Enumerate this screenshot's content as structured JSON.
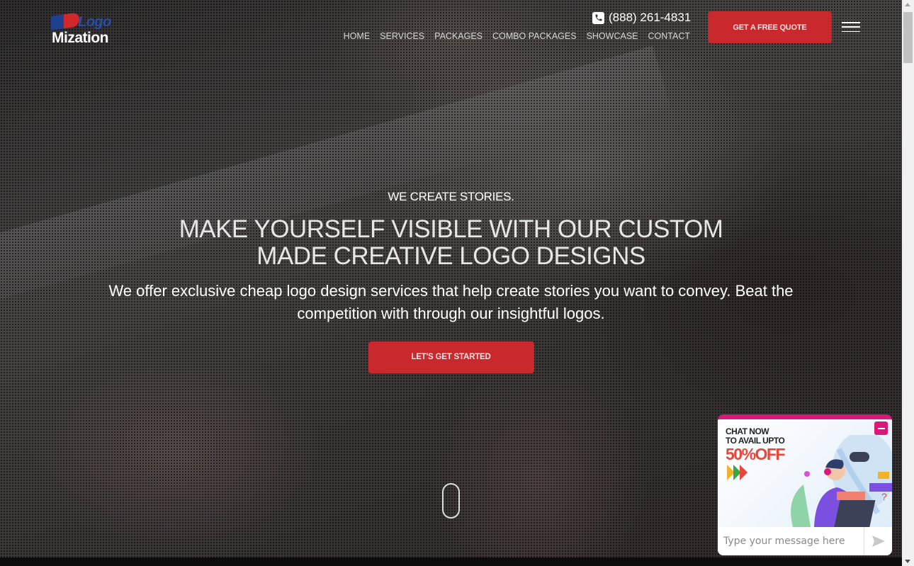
{
  "brand": {
    "logo_top": "Logo",
    "logo_bottom": "Mization"
  },
  "header": {
    "phone": "(888) 261-4831",
    "nav": [
      "HOME",
      "SERVICES",
      "PACKAGES",
      "COMBO PACKAGES",
      "SHOWCASE",
      "CONTACT"
    ],
    "quote_button": "GET A FREE QUOTE",
    "menu_icon": "hamburger-icon"
  },
  "hero": {
    "tagline": "WE CREATE STORIES.",
    "headline_line1": "MAKE YOURSELF VISIBLE WITH OUR CUSTOM",
    "headline_line2": "MADE CREATIVE LOGO DESIGNS",
    "subtext": "We offer exclusive cheap logo design services that help create stories you want to convey. Beat the competition with through our insightful logos.",
    "cta_button": "LET'S GET STARTED",
    "scroll_indicator": "mouse-scroll-icon"
  },
  "chat_widget": {
    "line1": "CHAT NOW",
    "line2": "TO AVAIL UPTO",
    "offer": "50%OFF",
    "input_placeholder": "Type your message here",
    "send_icon": "send-icon",
    "minimize_icon": "minimize-icon",
    "arrow_colors": [
      "#f0b429",
      "#3aa64a",
      "#e8473a"
    ]
  },
  "colors": {
    "accent_red": "#c9282d",
    "chat_pink": "#d8197a"
  }
}
